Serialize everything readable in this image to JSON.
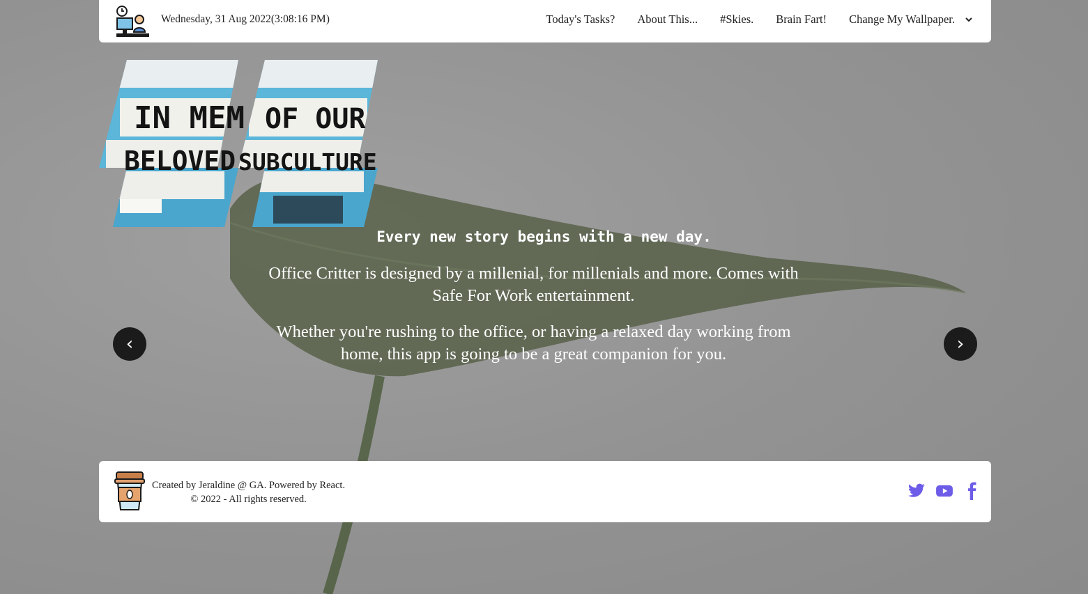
{
  "header": {
    "datetime": "Wednesday, 31 Aug 2022(3:08:16 PM)",
    "nav": [
      {
        "label": "Today's Tasks?"
      },
      {
        "label": "About This..."
      },
      {
        "label": "#Skies."
      },
      {
        "label": "Brain Fart!"
      },
      {
        "label": "Change My Wallpaper."
      }
    ],
    "logo_icon": "office-worker-clock-icon",
    "dropdown_icon": "chevron-down-icon"
  },
  "hero": {
    "image_text": [
      "IN MEM",
      "OF OUR",
      "BELOVED",
      "SUBCULTURE"
    ],
    "tagline": "Every new story begins with a new day.",
    "paragraphs": [
      "Office Critter is designed by a millenial, for millenials and more. Comes with Safe For Work entertainment.",
      "Whether you're rushing to the office, or having a relaxed day working from home, this app is going to be a great companion for you."
    ],
    "prev_label": "‹",
    "next_label": "›"
  },
  "footer": {
    "credit_line1": "Created by Jeraldine @ GA. Powered by React.",
    "credit_line2": "© 2022 - All rights reserved.",
    "socials": [
      {
        "name": "twitter-icon"
      },
      {
        "name": "youtube-icon"
      },
      {
        "name": "facebook-icon"
      }
    ],
    "cup_icon": "coffee-cup-icon"
  },
  "colors": {
    "background": "#8f8f8f",
    "social_accent": "#6d5ce8",
    "arrow_bg": "#1b1b1b",
    "panel": "#ffffff"
  }
}
